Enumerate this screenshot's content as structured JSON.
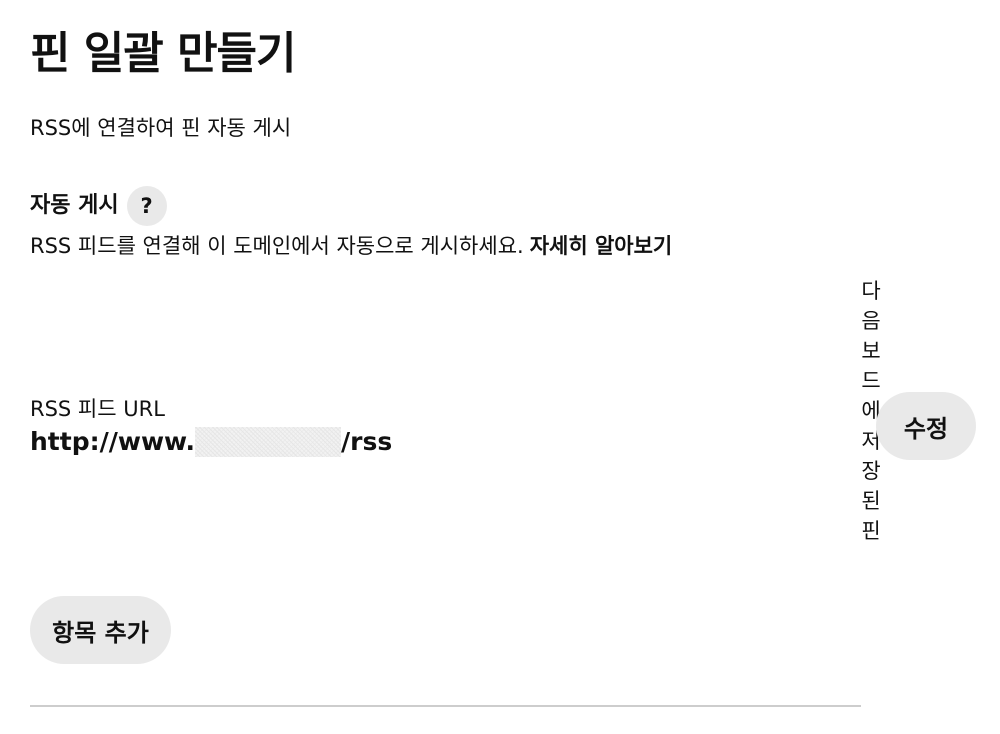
{
  "page": {
    "title": "핀 일괄 만들기",
    "subtitle": "RSS에 연결하여 핀 자동 게시"
  },
  "auto_publish": {
    "heading": "자동 게시",
    "help_label": "?",
    "description": "RSS 피드를 연결해 이 도메인에서 자동으로 게시하세요.",
    "learn_more": "자세히 알아보기"
  },
  "feed": {
    "label": "RSS 피드 URL",
    "url_prefix": "http://www.",
    "url_suffix": "/rss",
    "saved_board_label": "다음 보드에 저장된 핀",
    "edit_label": "수정"
  },
  "actions": {
    "add_item_label": "항목 추가"
  }
}
